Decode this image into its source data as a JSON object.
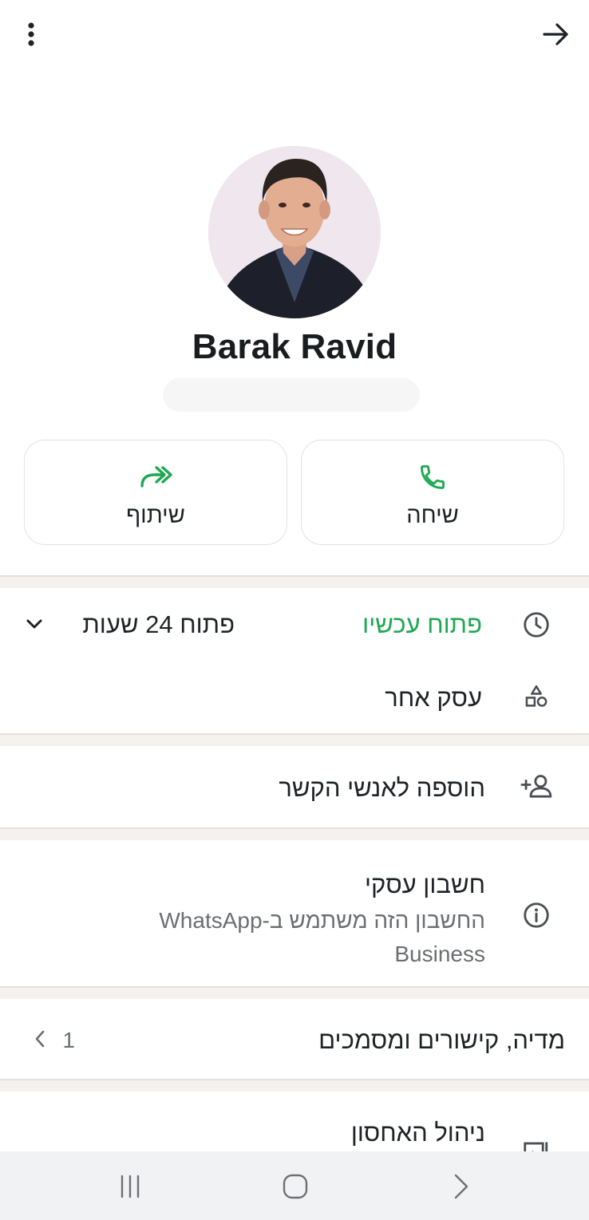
{
  "topbar": {
    "menu_icon": "more-vert-icon",
    "back_icon": "arrow-forward-icon"
  },
  "profile": {
    "name": "Barak Ravid"
  },
  "actions": {
    "share": {
      "label": "שיתוף",
      "icon": "share-forward-icon"
    },
    "call": {
      "label": "שיחה",
      "icon": "phone-icon"
    }
  },
  "hours": {
    "status": "פתוח עכשיו",
    "detail": "פתוח 24 שעות"
  },
  "category": {
    "label": "עסק אחר"
  },
  "add_contact": {
    "label": "הוספה לאנשי הקשר"
  },
  "business": {
    "title": "חשבון עסקי",
    "subtitle": "החשבון הזה משתמש ב-WhatsApp Business"
  },
  "media": {
    "label": "מדיה, קישורים ומסמכים",
    "count": "1"
  },
  "storage": {
    "label": "ניהול האחסון"
  },
  "colors": {
    "accent": "#1da851",
    "text": "#1f2326",
    "secondary": "#6b6f72",
    "separator": "#f4f1ef"
  }
}
